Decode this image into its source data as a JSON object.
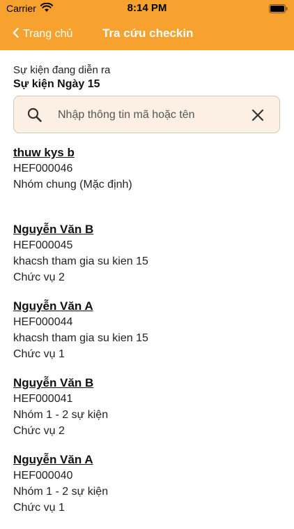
{
  "status_bar": {
    "carrier": "Carrier",
    "time": "8:14 PM"
  },
  "navbar": {
    "back_label": "Trang chủ",
    "title": "Tra cứu checkin",
    "color": "#F7A22F"
  },
  "event": {
    "caption": "Sự kiện đang diễn ra",
    "name": "Sự kiện Ngày 15"
  },
  "search": {
    "placeholder": "Nhập thông tin mã hoặc tên",
    "value": ""
  },
  "attendees": [
    {
      "name": "thuw kys b",
      "code": "HEF000046",
      "group": "Nhóm chung (Mặc định)",
      "position": ""
    },
    {
      "name": "Nguyễn Văn B",
      "code": "HEF000045",
      "group": "khacsh tham gia su kien 15",
      "position": "Chức vụ 2"
    },
    {
      "name": "Nguyễn Văn A",
      "code": "HEF000044",
      "group": "khacsh tham gia su kien 15",
      "position": "Chức vụ 1"
    },
    {
      "name": "Nguyễn Văn B",
      "code": "HEF000041",
      "group": "Nhóm 1 - 2 sự kiện",
      "position": "Chức vụ 2"
    },
    {
      "name": "Nguyễn Văn A",
      "code": "HEF000040",
      "group": "Nhóm 1 - 2 sự kiện",
      "position": "Chức vụ 1"
    }
  ]
}
